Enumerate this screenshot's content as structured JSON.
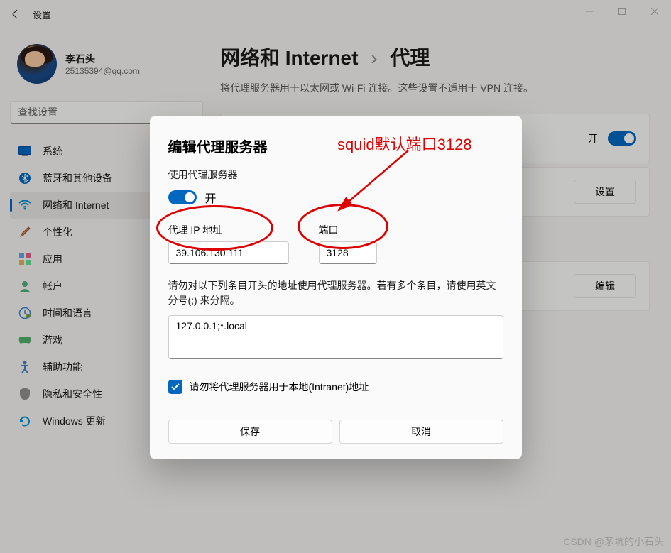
{
  "window": {
    "title": "设置"
  },
  "profile": {
    "name": "李石头",
    "email": "25135394@qq.com"
  },
  "search": {
    "placeholder": "查找设置"
  },
  "nav": {
    "items": [
      {
        "label": "系统"
      },
      {
        "label": "蓝牙和其他设备"
      },
      {
        "label": "网络和 Internet"
      },
      {
        "label": "个性化"
      },
      {
        "label": "应用"
      },
      {
        "label": "帐户"
      },
      {
        "label": "时间和语言"
      },
      {
        "label": "游戏"
      },
      {
        "label": "辅助功能"
      },
      {
        "label": "隐私和安全性"
      },
      {
        "label": "Windows 更新"
      }
    ]
  },
  "breadcrumb": {
    "parent": "网络和 Internet",
    "sep": "›",
    "current": "代理"
  },
  "main": {
    "subtitle": "将代理服务器用于以太网或 Wi-Fi 连接。这些设置不适用于 VPN 连接。",
    "panel1": {
      "status": "开"
    },
    "panel2": {
      "button": "设置"
    },
    "panel3": {
      "button": "编辑"
    }
  },
  "modal": {
    "title": "编辑代理服务器",
    "use_label": "使用代理服务器",
    "toggle_label": "开",
    "ip_label": "代理 IP 地址",
    "ip_value": "39.106.130.111",
    "port_label": "端口",
    "port_value": "3128",
    "bypass_desc": "请勿对以下列条目开头的地址使用代理服务器。若有多个条目，请使用英文分号(;) 来分隔。",
    "bypass_value": "127.0.0.1;*.local",
    "intranet_label": "请勿将代理服务器用于本地(Intranet)地址",
    "save": "保存",
    "cancel": "取消"
  },
  "annotation": {
    "text": "squid默认端口3128"
  },
  "watermark": "CSDN @茅坑的小石头"
}
